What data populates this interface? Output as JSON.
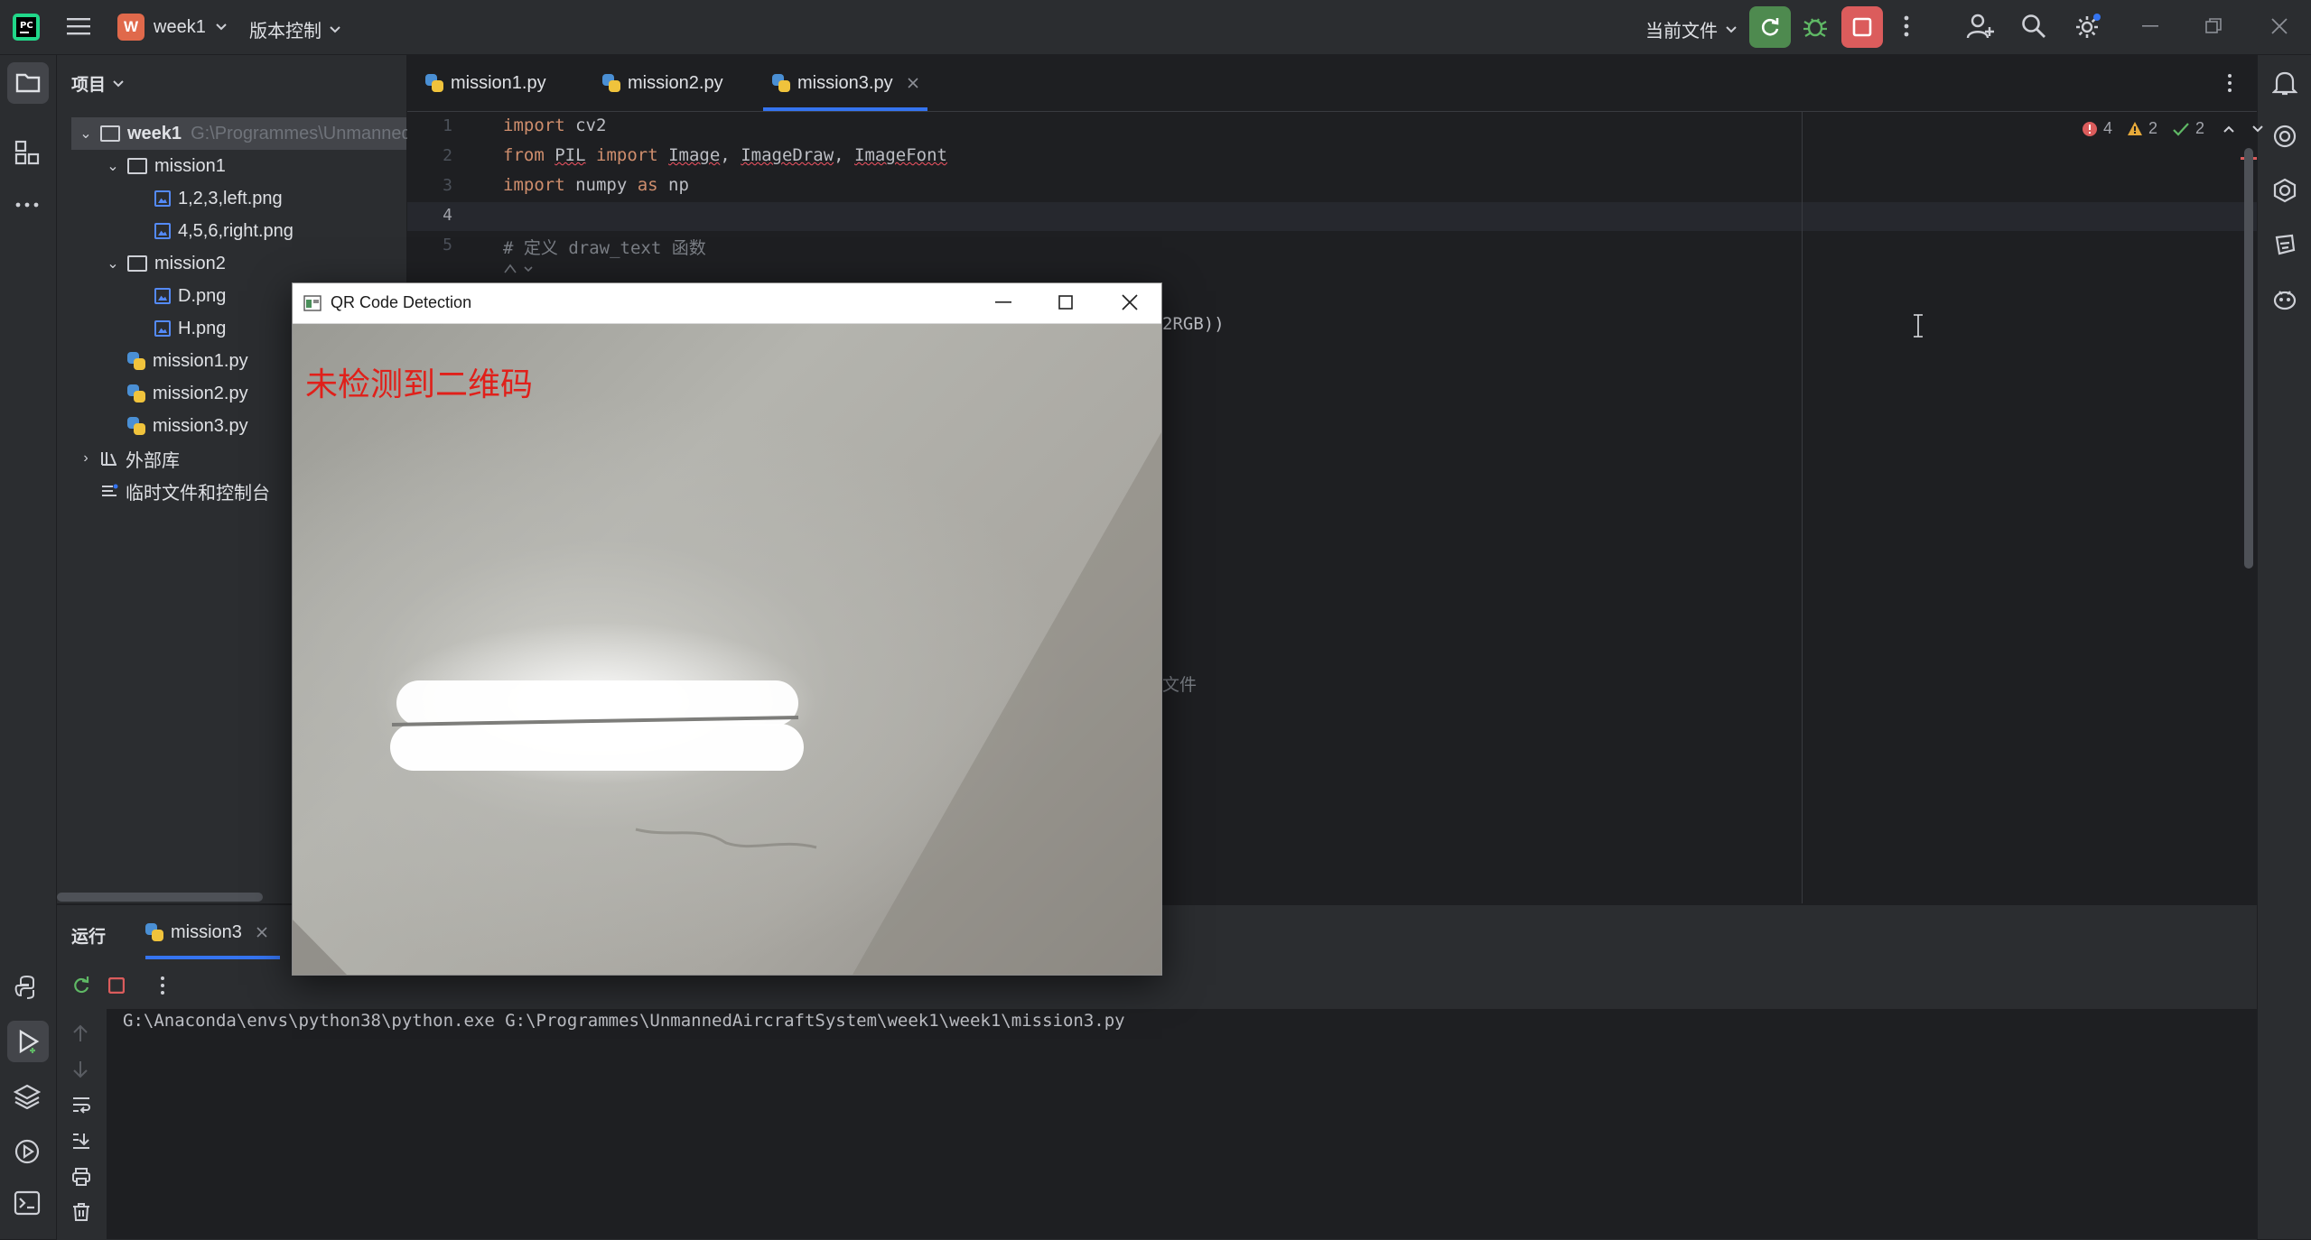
{
  "titlebar": {
    "project_badge": "W",
    "project_name": "week1",
    "vcs_label": "版本控制",
    "run_config": "当前文件"
  },
  "project_panel": {
    "title": "项目",
    "tree": [
      {
        "label": "week1",
        "path": "G:\\Programmes\\UnmannedA"
      },
      {
        "label": "mission1"
      },
      {
        "label": "1,2,3,left.png"
      },
      {
        "label": "4,5,6,right.png"
      },
      {
        "label": "mission2"
      },
      {
        "label": "D.png"
      },
      {
        "label": "H.png"
      },
      {
        "label": "mission1.py"
      },
      {
        "label": "mission2.py"
      },
      {
        "label": "mission3.py"
      },
      {
        "label": "外部库"
      },
      {
        "label": "临时文件和控制台"
      }
    ]
  },
  "tabs": [
    {
      "label": "mission1.py"
    },
    {
      "label": "mission2.py"
    },
    {
      "label": "mission3.py"
    }
  ],
  "editor": {
    "line_numbers": [
      "1",
      "2",
      "3",
      "4",
      "5"
    ],
    "inspections": {
      "errors": "4",
      "warnings": "2",
      "ok": "2"
    },
    "line1": {
      "kw": "import",
      "rest": " cv2"
    },
    "line2": {
      "kw1": "from",
      "mod": "PIL",
      "kw2": "import",
      "n1": "Image",
      "n2": "ImageDraw",
      "n3": "ImageFont"
    },
    "line3": {
      "kw1": "import",
      "mid": " numpy ",
      "kw2": "as",
      "rest": " np"
    },
    "line5": "# 定义 draw_text 函数",
    "fragment_right": "2RGB))",
    "fragment_lower": "文件"
  },
  "run": {
    "title": "运行",
    "tab": "mission3",
    "command": "G:\\Anaconda\\envs\\python38\\python.exe G:\\Programmes\\UnmannedAircraftSystem\\week1\\week1\\mission3.py"
  },
  "qr_window": {
    "title": "QR Code Detection",
    "overlay_text": "未检测到二维码",
    "overlay_color": "#e0201a"
  },
  "colors": {
    "accent": "#3574f0",
    "run_green": "#4e8a4f",
    "stop_red": "#db5c5c"
  }
}
